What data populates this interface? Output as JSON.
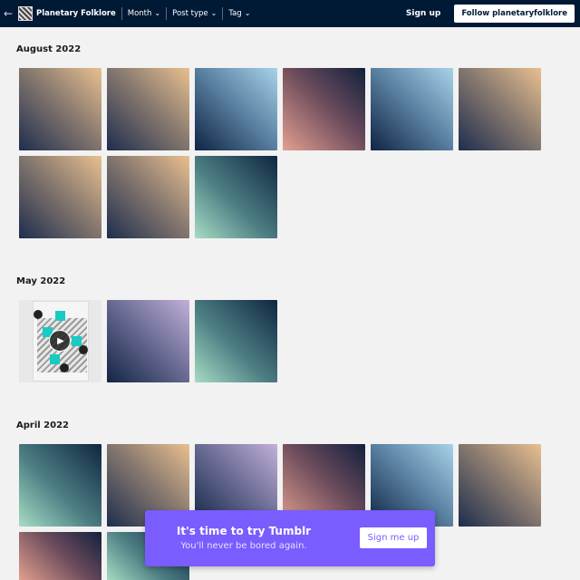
{
  "topbar": {
    "back_icon": "arrow-left-icon",
    "blog_name": "Planetary Folklore",
    "filters": [
      "Month",
      "Post type",
      "Tag"
    ],
    "signup_label": "Sign up",
    "follow_label": "Follow planetaryfolklore"
  },
  "sections": [
    {
      "title": "August 2022",
      "tiles": [
        "tan",
        "tan",
        "blue",
        "rose",
        "blue",
        "tan",
        "tan",
        "tan",
        "teal"
      ]
    },
    {
      "title": "May 2022",
      "tiles": [
        "video",
        "lav",
        "teal"
      ]
    },
    {
      "title": "April 2022",
      "tiles": [
        "teal",
        "tan",
        "lav",
        "rose",
        "blue",
        "tan",
        "rose",
        "teal"
      ]
    }
  ],
  "banner": {
    "title": "It's time to try Tumblr",
    "subtitle": "You'll never be bored again.",
    "button_label": "Sign me up"
  },
  "colors": {
    "topbar": "#001935",
    "banner": "#7b5cff",
    "background": "#f2f2f2"
  }
}
